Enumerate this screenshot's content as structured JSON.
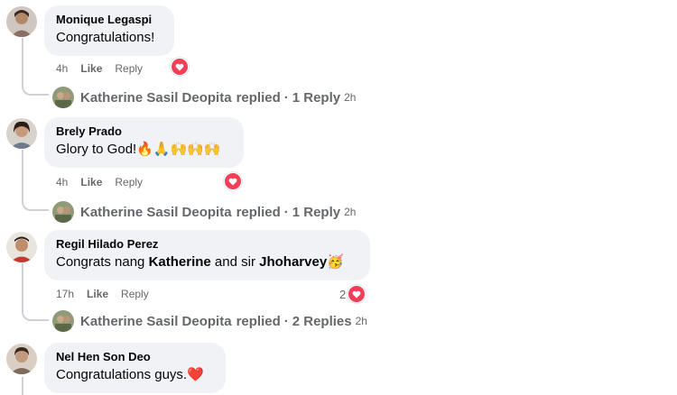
{
  "comments": [
    {
      "author": "Monique Legaspi",
      "text": "Congratulations!",
      "time": "4h",
      "like_label": "Like",
      "reply_label": "Reply",
      "reaction_count": "",
      "replies": {
        "who": "Katherine Sasil Deopita",
        "action": "replied",
        "sep": "·",
        "count_label": "1 Reply",
        "time": "2h"
      }
    },
    {
      "author": "Brely Prado",
      "text": "Glory to God!🔥🙏🙌🙌🙌",
      "time": "4h",
      "like_label": "Like",
      "reply_label": "Reply",
      "reaction_count": "",
      "replies": {
        "who": "Katherine Sasil Deopita",
        "action": "replied",
        "sep": "·",
        "count_label": "1 Reply",
        "time": "2h"
      }
    },
    {
      "author": "Regil Hilado Perez",
      "text_parts": [
        "Congrats nang ",
        "Katherine",
        " and sir ",
        "Jhoharvey",
        "🥳"
      ],
      "time": "17h",
      "like_label": "Like",
      "reply_label": "Reply",
      "reaction_count": "2",
      "replies": {
        "who": "Katherine Sasil Deopita",
        "action": "replied",
        "sep": "·",
        "count_label": "2 Replies",
        "time": "2h"
      }
    },
    {
      "author": "Nel Hen Son Deo",
      "text": "Congratulations guys.❤️"
    }
  ],
  "colors": {
    "bubble": "#f0f2f5",
    "heart": "#f33e58",
    "meta": "#65676b",
    "line": "#ced0d4"
  },
  "icons": {
    "reaction": "heart-icon"
  }
}
